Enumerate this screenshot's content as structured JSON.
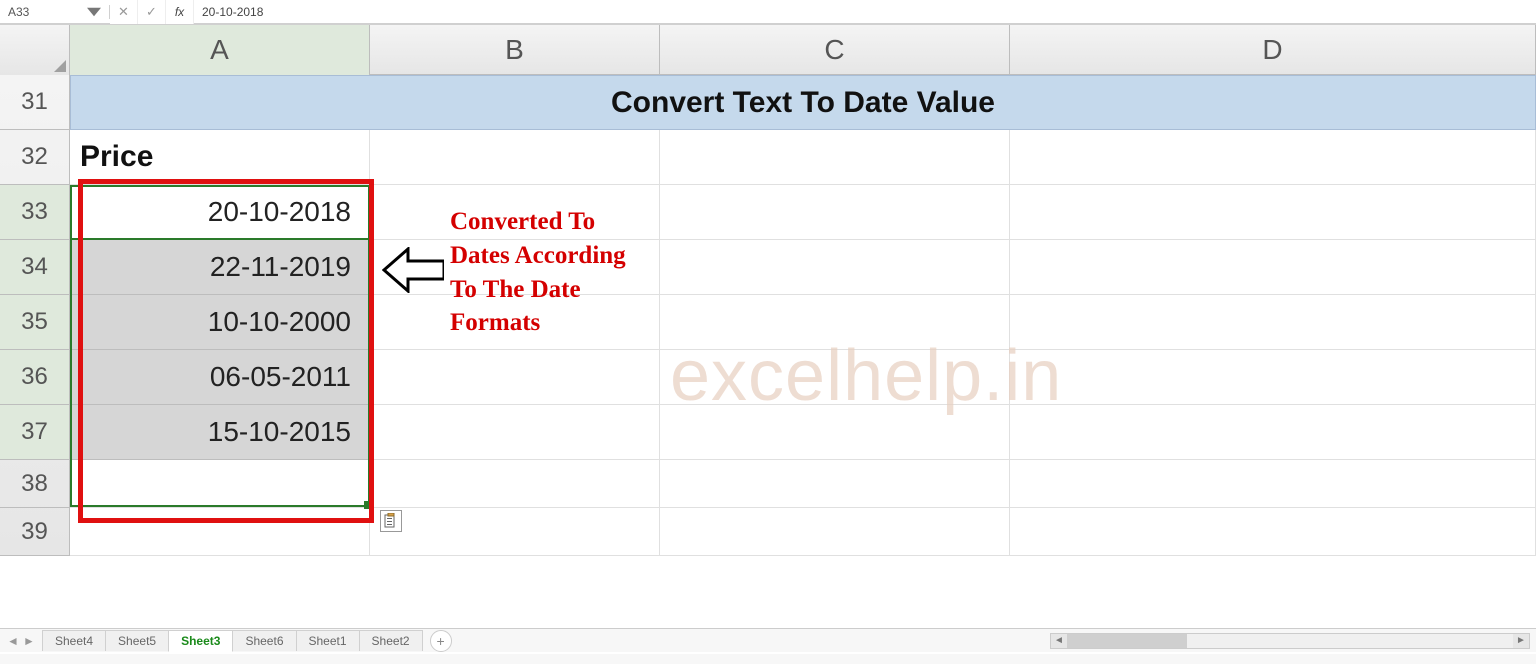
{
  "formula_bar": {
    "name_box_value": "A33",
    "cancel_label": "✕",
    "confirm_label": "✓",
    "fx_label": "fx",
    "formula_value": "20-10-2018"
  },
  "columns": {
    "A": "A",
    "B": "B",
    "C": "C",
    "D": "D"
  },
  "rows": {
    "31": "31",
    "32": "32",
    "33": "33",
    "34": "34",
    "35": "35",
    "36": "36",
    "37": "37",
    "38": "38",
    "39": "39"
  },
  "cells": {
    "title": "Convert Text To Date Value",
    "price_label": "Price",
    "A33": "20-10-2018",
    "A34": "22-11-2019",
    "A35": "10-10-2000",
    "A36": "06-05-2011",
    "A37": "15-10-2015"
  },
  "annotation": {
    "line1": "Converted To",
    "line2": "Dates According",
    "line3": "To The Date",
    "line4": "Formats"
  },
  "watermark": "excelhelp.in",
  "tabs": {
    "list": [
      "Sheet4",
      "Sheet5",
      "Sheet3",
      "Sheet6",
      "Sheet1",
      "Sheet2"
    ],
    "active_index": 2,
    "add_label": "+"
  },
  "icons": {
    "smart_tag": "paste-options-icon",
    "arrow": "left-arrow-icon"
  },
  "colors": {
    "selection_green": "#2a7a2a",
    "callout_red": "#e01010",
    "annotation_red": "#d40000",
    "title_fill": "#c5d9ec",
    "watermark": "#e8cfc0"
  }
}
